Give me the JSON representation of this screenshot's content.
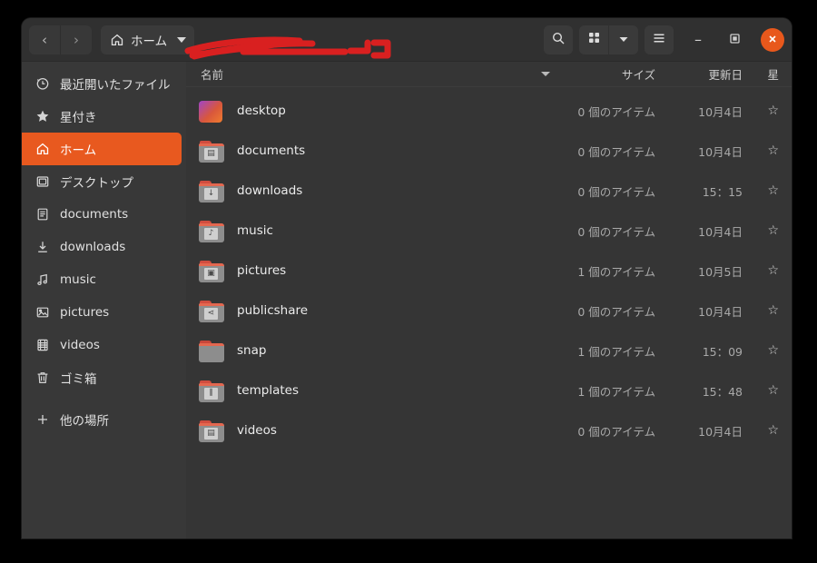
{
  "window": {
    "title": "ホーム",
    "accent_color": "#e8591f",
    "header_bg": "#303030",
    "sidebar_bg": "#383838",
    "content_bg": "#353535"
  },
  "header": {
    "back_label": "‹",
    "forward_label": "›",
    "path_label": "ホーム",
    "path_icon": "home-icon",
    "search_icon": "search-icon",
    "grid_view_icon": "grid-view-icon",
    "view_dropdown_icon": "chevron-down-icon",
    "menu_icon": "hamburger-menu-icon",
    "minimize_label": "–",
    "maximize_label": "▣",
    "close_label": "✕"
  },
  "sidebar": {
    "items": [
      {
        "label": "最近開いたファイル",
        "icon": "clock-icon",
        "selected": false
      },
      {
        "label": "星付き",
        "icon": "star-icon",
        "selected": false
      },
      {
        "label": "ホーム",
        "icon": "home-icon",
        "selected": true
      },
      {
        "label": "デスクトップ",
        "icon": "desktop-icon",
        "selected": false
      },
      {
        "label": "documents",
        "icon": "document-icon",
        "selected": false
      },
      {
        "label": "downloads",
        "icon": "download-icon",
        "selected": false
      },
      {
        "label": "music",
        "icon": "music-note-icon",
        "selected": false
      },
      {
        "label": "pictures",
        "icon": "picture-icon",
        "selected": false
      },
      {
        "label": "videos",
        "icon": "video-icon",
        "selected": false
      },
      {
        "label": "ゴミ箱",
        "icon": "trash-icon",
        "selected": false
      },
      {
        "label": "他の場所",
        "icon": "plus-icon",
        "selected": false
      }
    ]
  },
  "file_list": {
    "columns": {
      "name": "名前",
      "size": "サイズ",
      "modified": "更新日",
      "star": "星"
    },
    "sort_indicator": "▼",
    "star_glyph": "☆",
    "rows": [
      {
        "name": "desktop",
        "icon": "gradient-folder-icon",
        "size": "0 個のアイテム",
        "modified": "10月4日",
        "star": "☆"
      },
      {
        "name": "documents",
        "icon": "folder-documents-icon",
        "size": "0 個のアイテム",
        "modified": "10月4日",
        "star": "☆"
      },
      {
        "name": "downloads",
        "icon": "folder-downloads-icon",
        "size": "0 個のアイテム",
        "modified": "15：15",
        "star": "☆"
      },
      {
        "name": "music",
        "icon": "folder-music-icon",
        "size": "0 個のアイテム",
        "modified": "10月4日",
        "star": "☆"
      },
      {
        "name": "pictures",
        "icon": "folder-pictures-icon",
        "size": "1 個のアイテム",
        "modified": "10月5日",
        "star": "☆"
      },
      {
        "name": "publicshare",
        "icon": "folder-share-icon",
        "size": "0 個のアイテム",
        "modified": "10月4日",
        "star": "☆"
      },
      {
        "name": "snap",
        "icon": "folder-plain-icon",
        "size": "1 個のアイテム",
        "modified": "15：09",
        "star": "☆"
      },
      {
        "name": "templates",
        "icon": "folder-templates-icon",
        "size": "1 個のアイテム",
        "modified": "15：48",
        "star": "☆"
      },
      {
        "name": "videos",
        "icon": "folder-videos-icon",
        "size": "0 個のアイテム",
        "modified": "10月4日",
        "star": "☆"
      }
    ]
  },
  "annotation": {
    "color": "#d92020",
    "shape": "hand-drawn-left-arrow"
  }
}
